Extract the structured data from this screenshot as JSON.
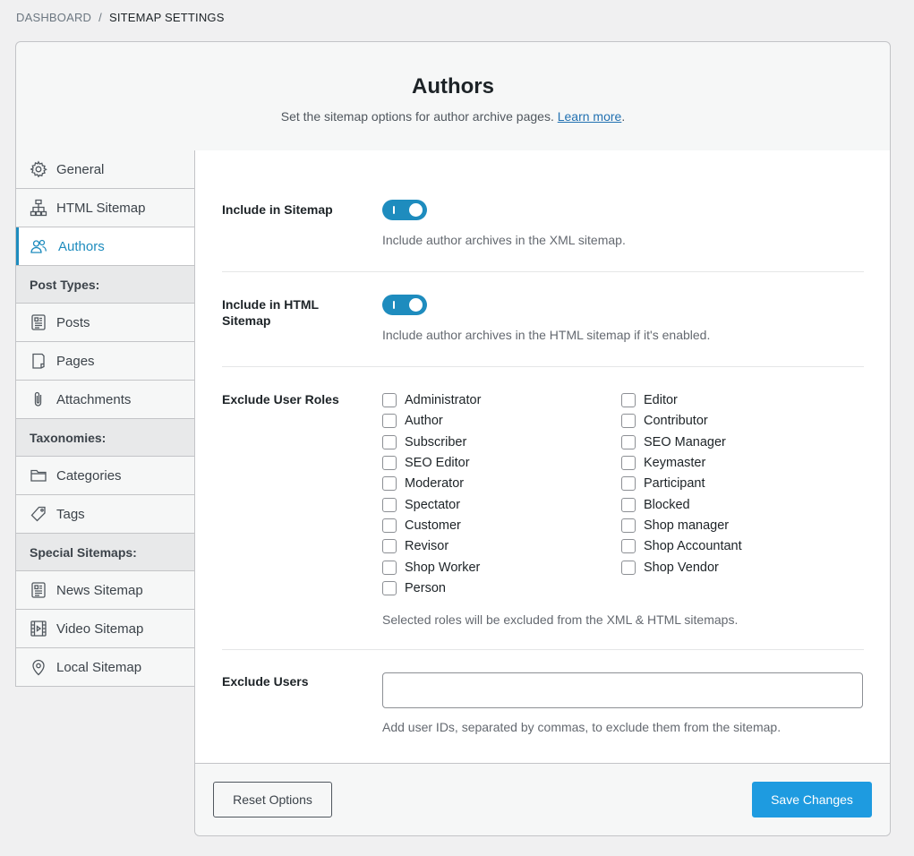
{
  "breadcrumb": {
    "home": "DASHBOARD",
    "separator": "/",
    "current": "SITEMAP SETTINGS"
  },
  "header": {
    "title": "Authors",
    "subtitle": "Set the sitemap options for author archive pages.",
    "learn_more": "Learn more",
    "period": "."
  },
  "sidebar": {
    "general": "General",
    "html_sitemap": "HTML Sitemap",
    "authors": "Authors",
    "post_types_heading": "Post Types:",
    "posts": "Posts",
    "pages": "Pages",
    "attachments": "Attachments",
    "taxonomies_heading": "Taxonomies:",
    "categories": "Categories",
    "tags": "Tags",
    "special_heading": "Special Sitemaps:",
    "news": "News Sitemap",
    "video": "Video Sitemap",
    "local": "Local Sitemap"
  },
  "settings": {
    "include_sitemap": {
      "label": "Include in Sitemap",
      "enabled": true,
      "help": "Include author archives in the XML sitemap."
    },
    "include_html": {
      "label": "Include in HTML Sitemap",
      "enabled": true,
      "help": "Include author archives in the HTML sitemap if it's enabled."
    },
    "exclude_roles": {
      "label": "Exclude User Roles",
      "roles": [
        "Administrator",
        "Editor",
        "Author",
        "Contributor",
        "Subscriber",
        "SEO Manager",
        "SEO Editor",
        "Keymaster",
        "Moderator",
        "Participant",
        "Spectator",
        "Blocked",
        "Customer",
        "Shop manager",
        "Revisor",
        "Shop Accountant",
        "Shop Worker",
        "Shop Vendor",
        "Person"
      ],
      "help": "Selected roles will be excluded from the XML & HTML sitemaps."
    },
    "exclude_users": {
      "label": "Exclude Users",
      "value": "",
      "help": "Add user IDs, separated by commas, to exclude them from the sitemap."
    }
  },
  "footer": {
    "reset_label": "Reset Options",
    "save_label": "Save Changes"
  },
  "colors": {
    "accent": "#1e8cbe",
    "save_button": "#1e9be0",
    "link": "#2271b1"
  }
}
